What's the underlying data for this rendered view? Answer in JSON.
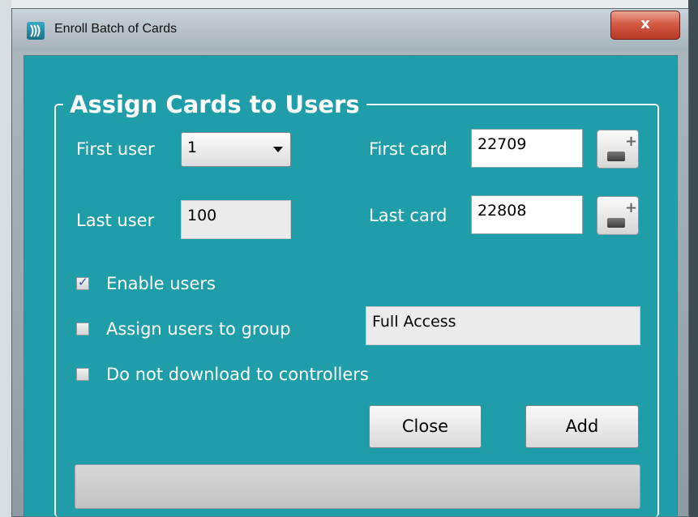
{
  "window": {
    "title": "Enroll Batch of Cards",
    "close_label": "x"
  },
  "group": {
    "legend": "Assign Cards to Users"
  },
  "fields": {
    "first_user_label": "First user",
    "first_user_value": "1",
    "last_user_label": "Last user",
    "last_user_value": "100",
    "first_card_label": "First card",
    "first_card_value": "22709",
    "last_card_label": "Last card",
    "last_card_value": "22808"
  },
  "options": {
    "enable_users_label": "Enable users",
    "enable_users_checked": true,
    "assign_group_label": "Assign users to group",
    "assign_group_checked": false,
    "group_value": "Full Access",
    "no_download_label": "Do not download to controllers",
    "no_download_checked": false
  },
  "buttons": {
    "close_label": "Close",
    "add_label": "Add"
  },
  "progress": {
    "value": 0
  },
  "colors": {
    "client_background": "#1f9eaa",
    "close_button": "#d45a44"
  },
  "icons": {
    "app": "app-logo-icon",
    "card_adjust": "plus-minus-icon",
    "check": "checkmark-icon",
    "dropdown": "chevron-down-icon"
  }
}
